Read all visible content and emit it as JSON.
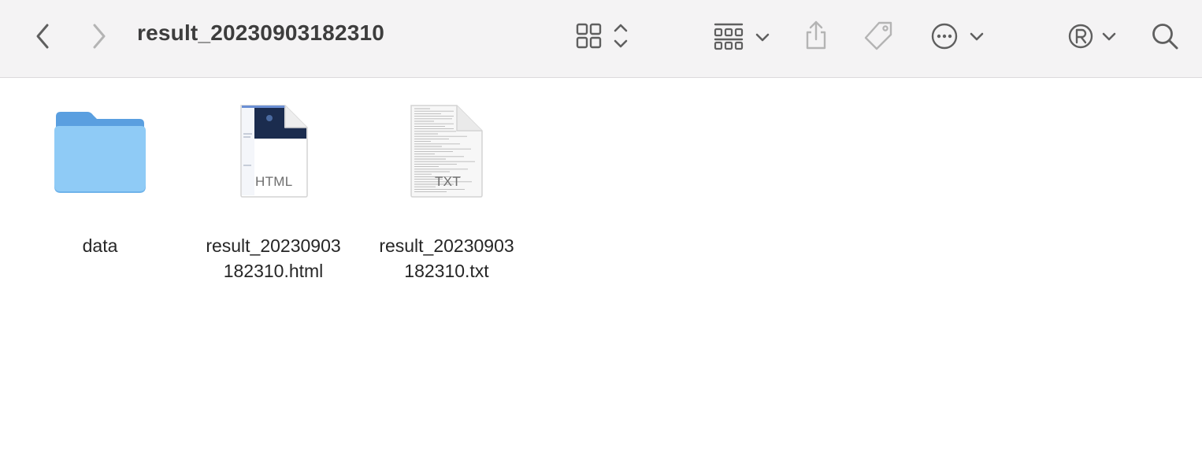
{
  "window": {
    "title": "result_20230903182310"
  },
  "toolbar": {
    "icons": [
      "chevron-left-icon",
      "chevron-right-icon",
      "grid-view-icon",
      "group-by-icon",
      "share-icon",
      "tag-icon",
      "more-actions-icon",
      "registered-extension-icon",
      "search-icon"
    ]
  },
  "files": [
    {
      "name_line1": "data",
      "name_line2": "",
      "kind": "folder"
    },
    {
      "name_line1": "result_20230903",
      "name_line2": "182310.html",
      "kind": "html",
      "ext": "HTML"
    },
    {
      "name_line1": "result_20230903",
      "name_line2": "182310.txt",
      "kind": "txt",
      "ext": "TXT"
    }
  ],
  "colors": {
    "folder": "#7ec4f5",
    "toolbar_bg": "#f4f3f4",
    "icon": "#5f5f5f"
  }
}
